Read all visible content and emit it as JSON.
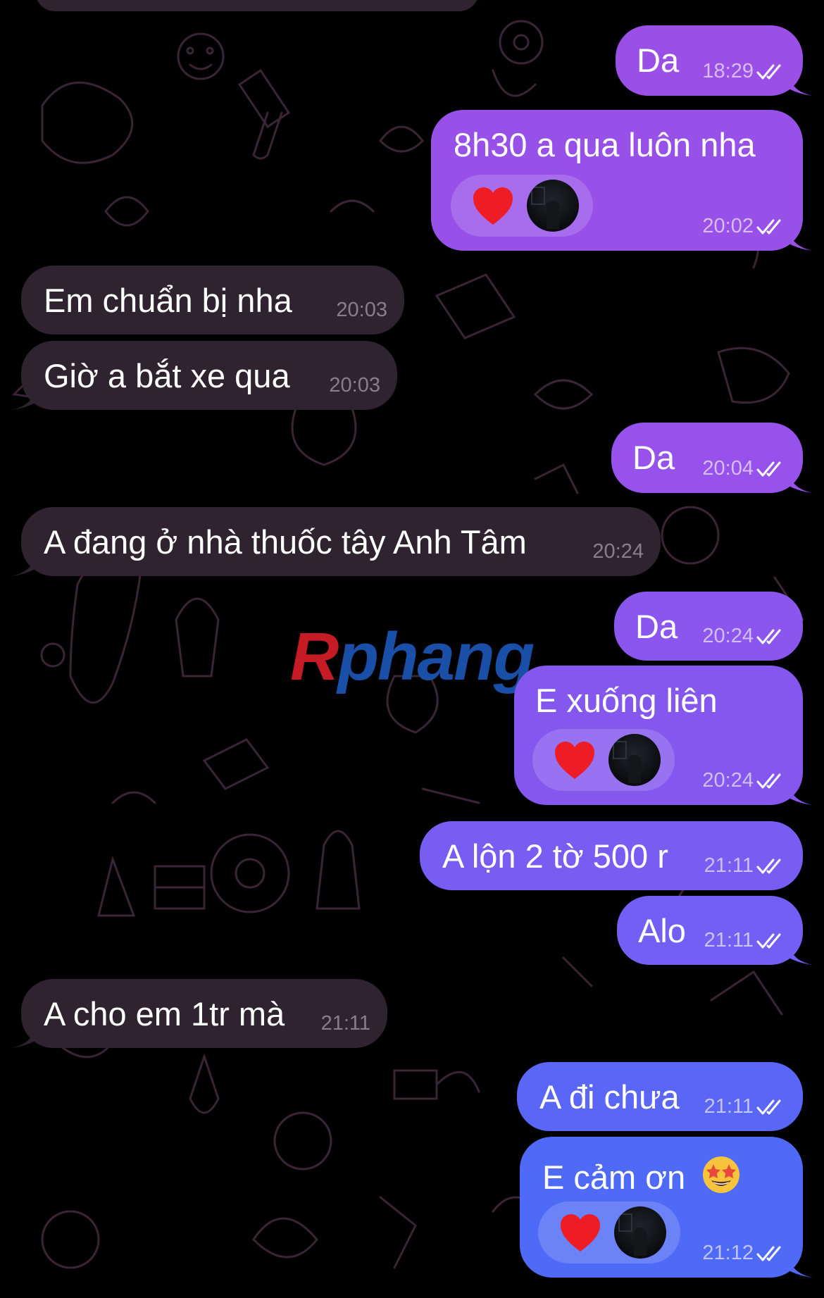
{
  "messages": [
    {
      "text": "Da",
      "time": "18:29"
    },
    {
      "text": "8h30 a qua luôn nha",
      "time": "20:02"
    },
    {
      "text": "Em chuẩn bị nha",
      "time": "20:03"
    },
    {
      "text": "Giờ a bắt xe qua",
      "time": "20:03"
    },
    {
      "text": "Da",
      "time": "20:04"
    },
    {
      "text": "A đang ở nhà thuốc tây Anh Tâm",
      "time": "20:24"
    },
    {
      "text": "Da",
      "time": "20:24"
    },
    {
      "text": "E xuống liên",
      "time": "20:24"
    },
    {
      "text": "A lộn 2 tờ 500 r",
      "time": "21:11"
    },
    {
      "text": "Alo",
      "time": "21:11"
    },
    {
      "text": "A cho em 1tr mà",
      "time": "21:11"
    },
    {
      "text": "A đi chưa",
      "time": "21:11"
    },
    {
      "text": "E cảm ơn",
      "time": "21:12"
    }
  ],
  "watermark": {
    "part1": "R",
    "part2": "phang"
  },
  "colors": {
    "background": "#000000",
    "incoming_bubble": "#2e232f",
    "outgoing_gradient_top": "#9a4fe6",
    "outgoing_gradient_bottom": "#3f6cf7",
    "reaction_heart": "#ee1c25"
  },
  "icons": {
    "read_status": "double-check-icon",
    "reaction_emoji": "heart-icon",
    "reaction_user": "avatar",
    "message_emoji": "star-struck-emoji"
  }
}
